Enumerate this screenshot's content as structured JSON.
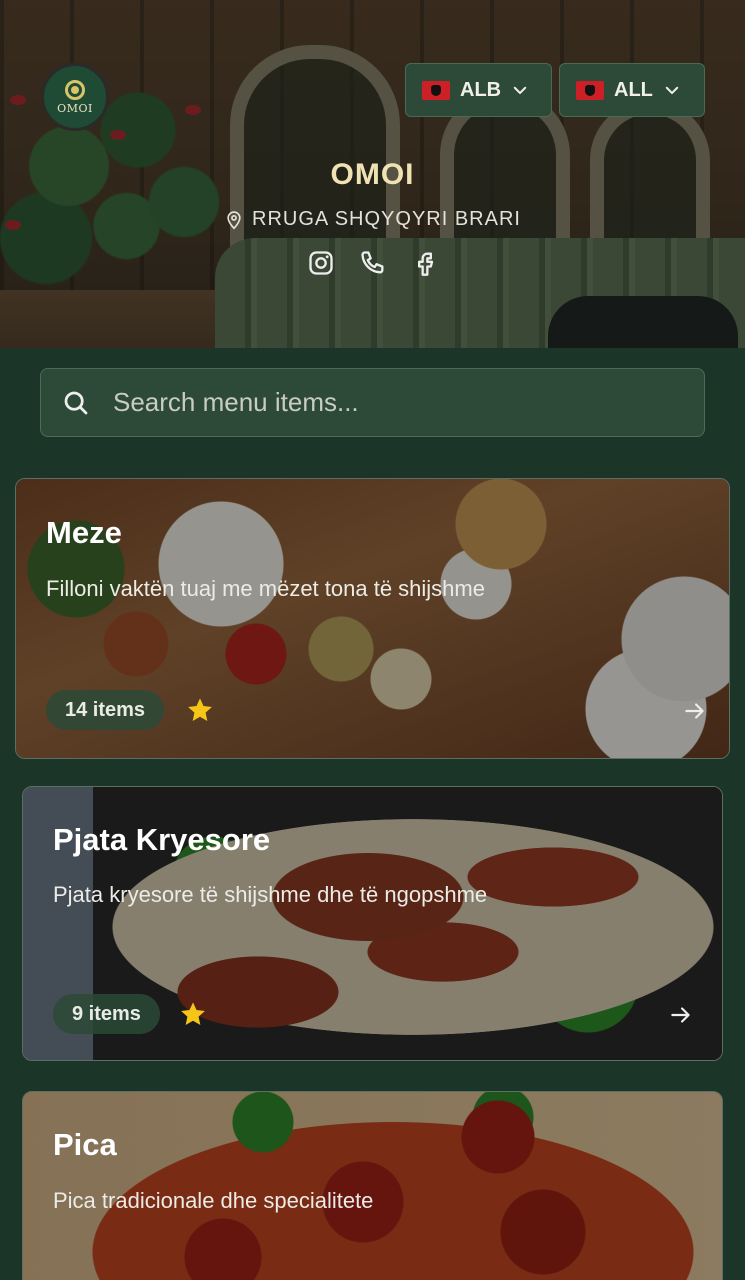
{
  "header": {
    "logo_text": "OMOI",
    "language": {
      "label": "ALB"
    },
    "currency": {
      "label": "ALL"
    },
    "venue_name": "OMOI",
    "address": "RRUGA SHQYQYRI BRARI",
    "socials": [
      "instagram-icon",
      "phone-icon",
      "facebook-icon"
    ]
  },
  "search": {
    "placeholder": "Search menu items..."
  },
  "categories": [
    {
      "title": "Meze",
      "description": "Filloni vaktën tuaj me mëzet tona të shijshme",
      "count": "14 items",
      "featured": true
    },
    {
      "title": "Pjata Kryesore",
      "description": "Pjata kryesore të shijshme dhe të ngopshme",
      "count": "9 items",
      "featured": true
    },
    {
      "title": "Pica",
      "description": "Pica tradicionale dhe specialitete"
    }
  ],
  "colors": {
    "background": "#1c3529",
    "panel": "#2c4a37",
    "accent_gold": "#f0e3b3",
    "star": "#f5c518"
  }
}
